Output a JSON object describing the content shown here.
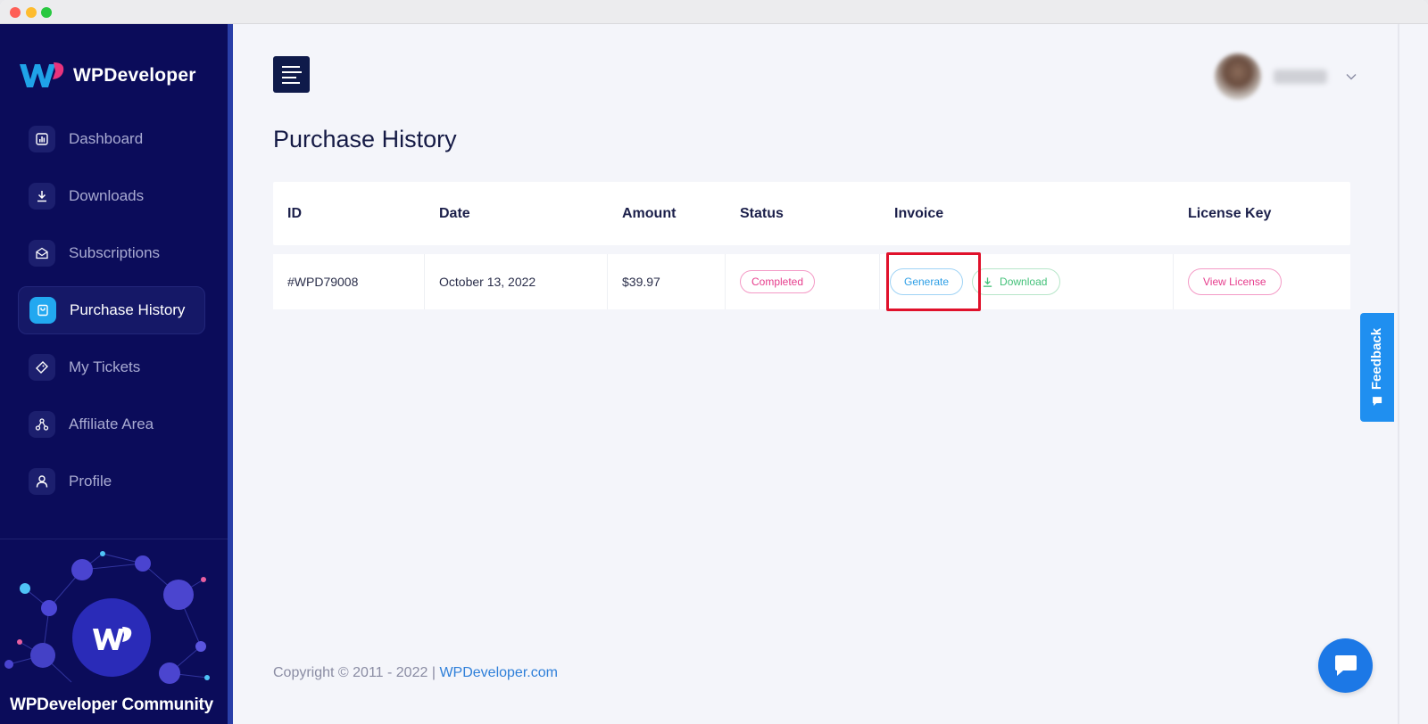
{
  "brand": {
    "name": "WPDeveloper"
  },
  "sidebar": {
    "items": [
      {
        "label": "Dashboard",
        "icon": "chart-icon",
        "active": false
      },
      {
        "label": "Downloads",
        "icon": "download-icon",
        "active": false
      },
      {
        "label": "Subscriptions",
        "icon": "envelope-open-icon",
        "active": false
      },
      {
        "label": "Purchase History",
        "icon": "bag-icon",
        "active": true
      },
      {
        "label": "My Tickets",
        "icon": "ticket-icon",
        "active": false
      },
      {
        "label": "Affiliate Area",
        "icon": "network-icon",
        "active": false
      },
      {
        "label": "Profile",
        "icon": "user-icon",
        "active": false
      }
    ],
    "community_label": "WPDeveloper Community"
  },
  "page": {
    "title": "Purchase History"
  },
  "table": {
    "headers": [
      "ID",
      "Date",
      "Amount",
      "Status",
      "Invoice",
      "License Key"
    ],
    "rows": [
      {
        "id": "#WPD79008",
        "date": "October 13, 2022",
        "amount": "$39.97",
        "status": "Completed",
        "generate_label": "Generate",
        "download_label": "Download",
        "license_label": "View License"
      }
    ]
  },
  "footer": {
    "copyright": "Copyright © 2011 - 2022 |",
    "link": "WPDeveloper.com"
  },
  "feedback": {
    "label": "Feedback"
  },
  "colors": {
    "sidebar": "#0b0c5a",
    "accent": "#22a8f0",
    "status_pink": "#e63c8c",
    "download_green": "#43c179",
    "highlight_red": "#e0112b"
  }
}
